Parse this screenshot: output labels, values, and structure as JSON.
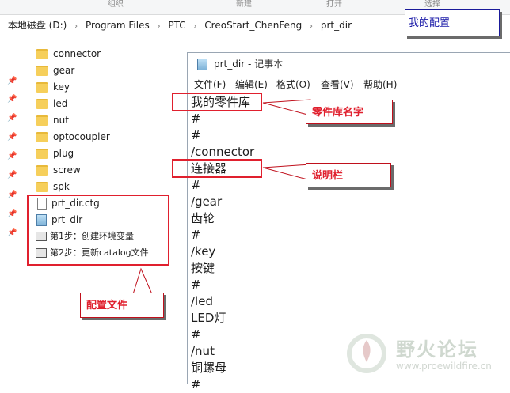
{
  "ribbon": {
    "items": [
      "组织",
      "新建",
      "打开",
      "选择"
    ]
  },
  "address": {
    "crumbs": [
      "本地磁盘 (D:)",
      "Program Files",
      "PTC",
      "CreoStart_ChenFeng",
      "prt_dir"
    ],
    "separator": "›"
  },
  "config_label": "我的配置",
  "files": [
    {
      "name": "connector",
      "type": "folder"
    },
    {
      "name": "gear",
      "type": "folder"
    },
    {
      "name": "key",
      "type": "folder"
    },
    {
      "name": "led",
      "type": "folder"
    },
    {
      "name": "nut",
      "type": "folder"
    },
    {
      "name": "optocoupler",
      "type": "folder"
    },
    {
      "name": "plug",
      "type": "folder"
    },
    {
      "name": "screw",
      "type": "folder"
    },
    {
      "name": "spk",
      "type": "folder"
    },
    {
      "name": "prt_dir.ctg",
      "type": "file"
    },
    {
      "name": "prt_dir",
      "type": "notepad"
    },
    {
      "name": "第1步：创建环境变量",
      "type": "batch"
    },
    {
      "name": "第2步：更新catalog文件",
      "type": "batch"
    }
  ],
  "notepad": {
    "title": "prt_dir - 记事本",
    "menu": [
      "文件(F)",
      "编辑(E)",
      "格式(O)",
      "查看(V)",
      "帮助(H)"
    ],
    "lines": [
      "我的零件库",
      "#",
      "#",
      "/connector",
      "连接器",
      "#",
      "/gear",
      "齿轮",
      "#",
      "/key",
      "按键",
      "#",
      "/led",
      "LED灯",
      "#",
      "/nut",
      "铜螺母",
      "#"
    ]
  },
  "callouts": {
    "library_name": "零件库名字",
    "description": "说明栏",
    "config_files": "配置文件"
  },
  "watermark": {
    "title": "野火论坛",
    "url": "www.proewildfire.cn"
  },
  "colors": {
    "annotation_red": "#e0202e",
    "config_blue": "#1a1aa8",
    "folder_yellow": "#f6cf5b"
  }
}
